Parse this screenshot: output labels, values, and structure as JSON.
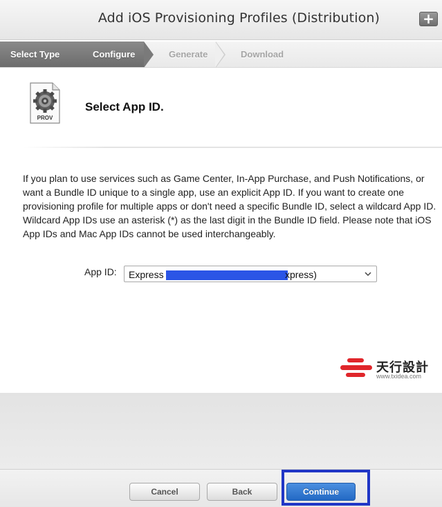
{
  "header": {
    "title": "Add iOS Provisioning Profiles (Distribution)",
    "add_button_label": "+"
  },
  "steps": [
    {
      "label": "Select Type",
      "state": "active"
    },
    {
      "label": "Configure",
      "state": "active"
    },
    {
      "label": "Generate",
      "state": "inactive"
    },
    {
      "label": "Download",
      "state": "inactive"
    }
  ],
  "section": {
    "icon_label": "PROV",
    "icon": "gear-document-icon",
    "title": "Select App ID."
  },
  "description": "If you plan to use services such as Game Center, In-App Purchase, and Push Notifications, or want a Bundle ID unique to a single app, use an explicit App ID. If you want to create one provisioning profile for multiple apps or don't need a specific Bundle ID, select a wildcard App ID. Wildcard App IDs use an asterisk (*) as the last digit in the Bundle ID field. Please note that iOS App IDs and Mac App IDs cannot be used interchangeably.",
  "app_id": {
    "label": "App ID:",
    "selected_prefix": "Express",
    "selected_suffix": "xpress)"
  },
  "watermark": {
    "name": "天行設計",
    "url": "www.txidea.com",
    "color": "#e0262b"
  },
  "buttons": {
    "cancel": "Cancel",
    "back": "Back",
    "continue": "Continue"
  },
  "colors": {
    "accent": "#2369c4",
    "highlight": "#2036c6",
    "redaction": "#2b55e6"
  }
}
